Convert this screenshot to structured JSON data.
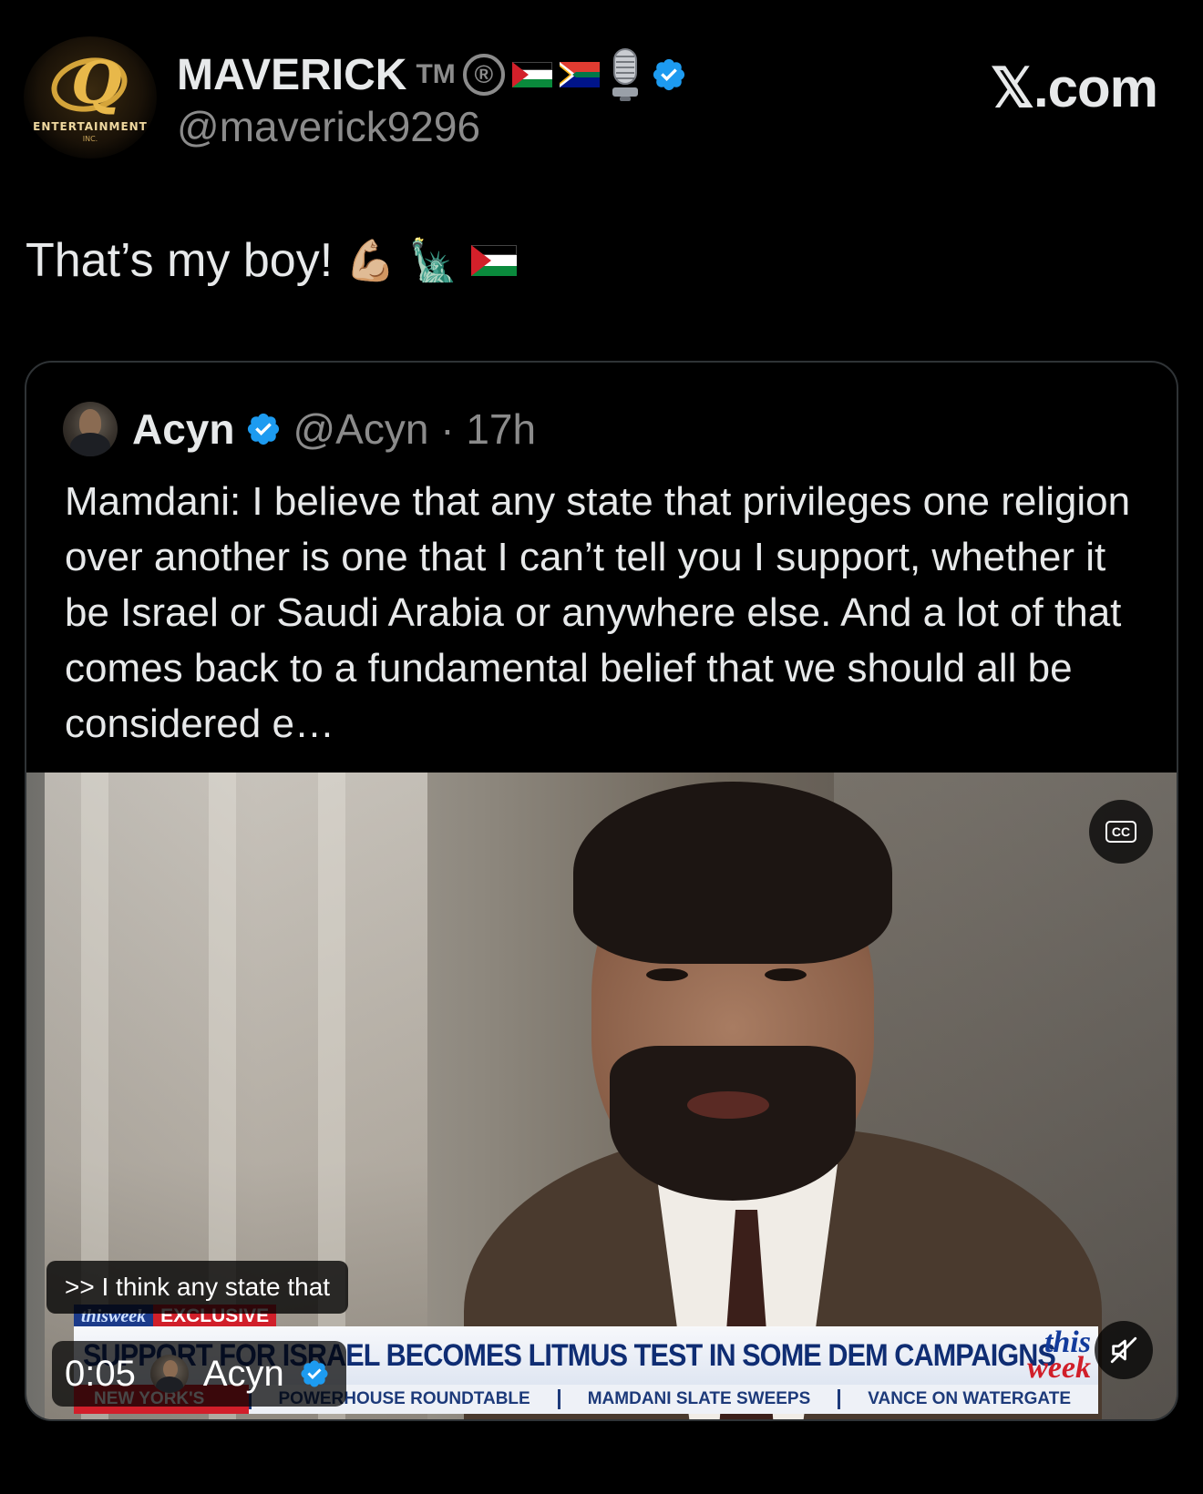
{
  "author": {
    "display_name": "MAVERICK",
    "tm": "TM",
    "registered": "®",
    "handle": "@maverick9296",
    "logo_text": "ENTERTAINMENT",
    "logo_sub": "INC."
  },
  "brand": "𝕏.com",
  "tweet": {
    "text": "That’s my boy!",
    "emojis": [
      "💪🏼",
      "🗽",
      "palestine-flag"
    ]
  },
  "quoted_tweet": {
    "name": "Acyn",
    "handle_time": "@Acyn · 17h",
    "body": "Mamdani: I believe that any state that privileges one religion over another is one that I can’t tell you I support, whether it be Israel or Saudi Arabia or anywhere else. And a lot of that comes back to a fundamental belief that we should all be considered e…"
  },
  "video": {
    "cc_label": "CC",
    "caption": ">> I think any state that",
    "time": "0:05",
    "uploader": "Acyn",
    "lower_third": {
      "tag_show": "thisweek",
      "tag_exclusive": "EXCLUSIVE",
      "headline": "SUPPORT FOR ISRAEL BECOMES LITMUS TEST IN SOME DEM CAMPAIGNS",
      "logo_line1": "this",
      "logo_line2": "week",
      "ticker": [
        "NEW YORK'S KINGMAKER?",
        "POWERHOUSE ROUNDTABLE",
        "MAMDANI SLATE SWEEPS",
        "VANCE ON WATERGATE"
      ]
    }
  },
  "colors": {
    "background": "#000000",
    "text": "#e7e9ea",
    "secondary": "#8b8b8b",
    "verified": "#1d9bf0",
    "border": "#2f3336"
  }
}
